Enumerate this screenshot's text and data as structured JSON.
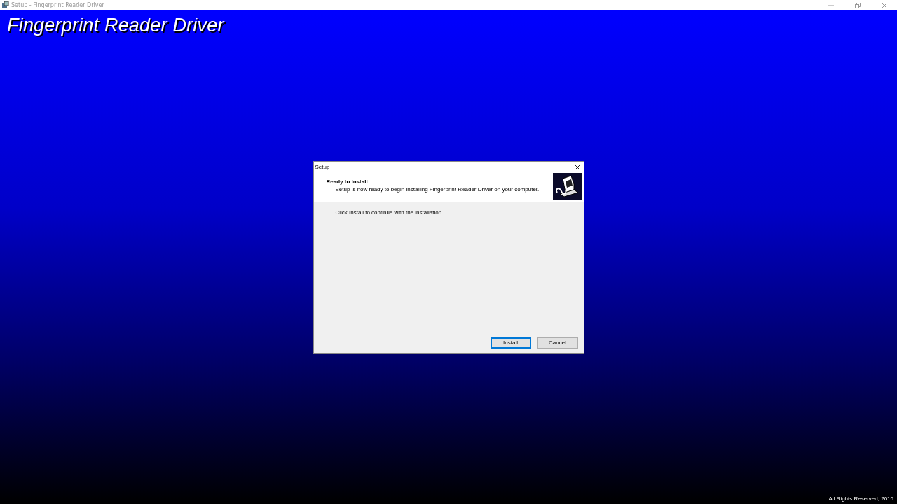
{
  "window": {
    "title": "Setup - Fingerprint Reader Driver"
  },
  "banner": {
    "title": "Fingerprint Reader Driver",
    "copyright": "All Rights Reserved, 2016"
  },
  "dialog": {
    "title": "Setup",
    "heading": "Ready to Install",
    "subheading": "Setup is now ready to begin installing Fingerprint Reader Driver on your computer.",
    "message": "Click Install to continue with the installation.",
    "buttons": [
      {
        "label": "Install",
        "default": true
      },
      {
        "label": "Cancel",
        "default": false
      }
    ]
  }
}
